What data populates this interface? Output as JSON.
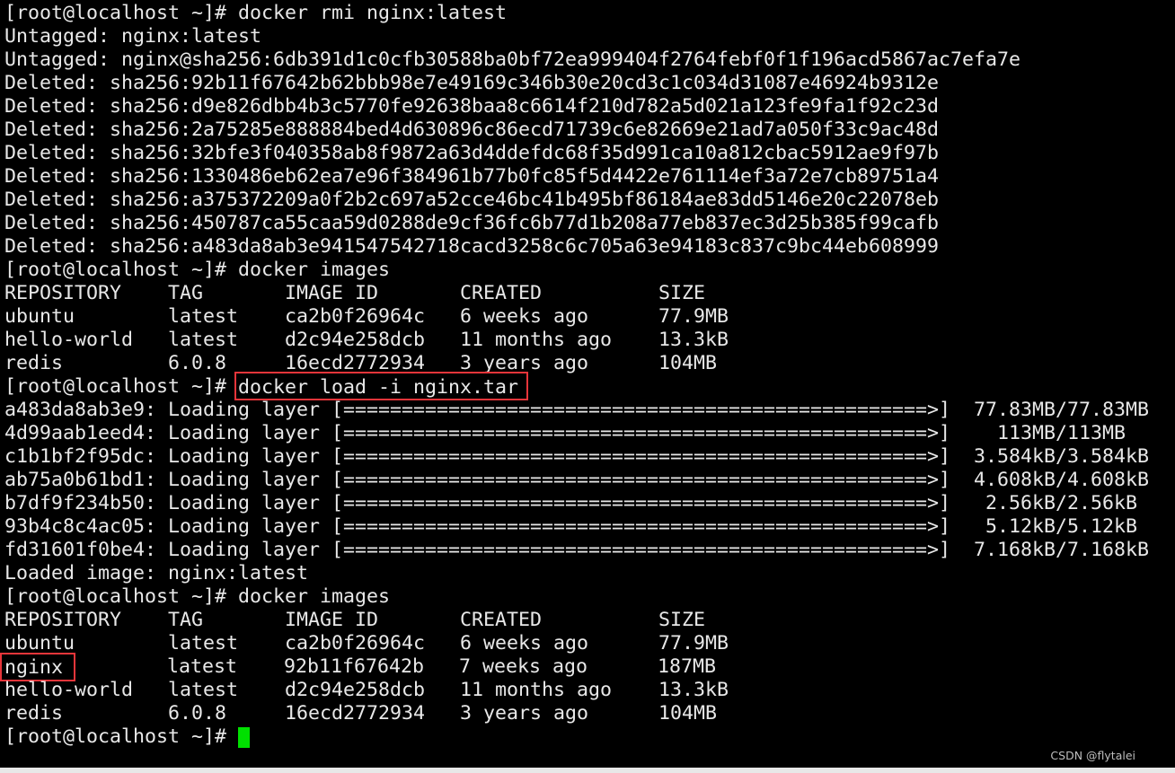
{
  "terminal": {
    "prompt": "[root@localhost ~]# ",
    "lines": [
      "[root@localhost ~]# docker rmi nginx:latest",
      "Untagged: nginx:latest",
      "Untagged: nginx@sha256:6db391d1c0cfb30588ba0bf72ea999404f2764febf0f1f196acd5867ac7efa7e",
      "Deleted: sha256:92b11f67642b62bbb98e7e49169c346b30e20cd3c1c034d31087e46924b9312e",
      "Deleted: sha256:d9e826dbb4b3c5770fe92638baa8c6614f210d782a5d021a123fe9fa1f92c23d",
      "Deleted: sha256:2a75285e888884bed4d630896c86ecd71739c6e82669e21ad7a050f33c9ac48d",
      "Deleted: sha256:32bfe3f040358ab8f9872a63d4ddefdc68f35d991ca10a812cbac5912ae9f97b",
      "Deleted: sha256:1330486eb62ea7e96f384961b77b0fc85f5d4422e761114ef3a72e7cb89751a4",
      "Deleted: sha256:a375372209a0f2b2c697a52cce46bc41b495bf86184ae83dd5146e20c22078eb",
      "Deleted: sha256:450787ca55caa59d0288de9cf36fc6b77d1b208a77eb837ec3d25b385f99cafb",
      "Deleted: sha256:a483da8ab3e941547542718cacd3258c6c705a63e94183c837c9bc44eb608999",
      "[root@localhost ~]# docker images",
      "REPOSITORY    TAG       IMAGE ID       CREATED          SIZE",
      "ubuntu        latest    ca2b0f26964c   6 weeks ago      77.9MB",
      "hello-world   latest    d2c94e258dcb   11 months ago    13.3kB",
      "redis         6.0.8     16ecd2772934   3 years ago      104MB"
    ],
    "load_command": "docker load -i nginx.tar",
    "layers": [
      "a483da8ab3e9: Loading layer [==================================================>]  77.83MB/77.83MB",
      "4d99aab1eed4: Loading layer [==================================================>]    113MB/113MB",
      "c1b1bf2f95dc: Loading layer [==================================================>]  3.584kB/3.584kB",
      "ab75a0b61bd1: Loading layer [==================================================>]  4.608kB/4.608kB",
      "b7df9f234b50: Loading layer [==================================================>]   2.56kB/2.56kB",
      "93b4c8c4ac05: Loading layer [==================================================>]   5.12kB/5.12kB",
      "fd31601f0be4: Loading layer [==================================================>]  7.168kB/7.168kB"
    ],
    "loaded": "Loaded image: nginx:latest",
    "images_command": "[root@localhost ~]# docker images",
    "images_header": "REPOSITORY    TAG       IMAGE ID       CREATED          SIZE",
    "images_row_ubuntu": "ubuntu        latest    ca2b0f26964c   6 weeks ago      77.9MB",
    "images_row_nginx_repo": "nginx",
    "images_row_nginx_rest": "         latest    92b11f67642b   7 weeks ago      187MB",
    "images_row_hello": "hello-world   latest    d2c94e258dcb   11 months ago    13.3kB",
    "images_row_redis": "redis         6.0.8     16ecd2772934   3 years ago      104MB",
    "cursor_color": "#00e000",
    "highlight_color": "#e8353a"
  },
  "watermark": "CSDN @flytalei"
}
